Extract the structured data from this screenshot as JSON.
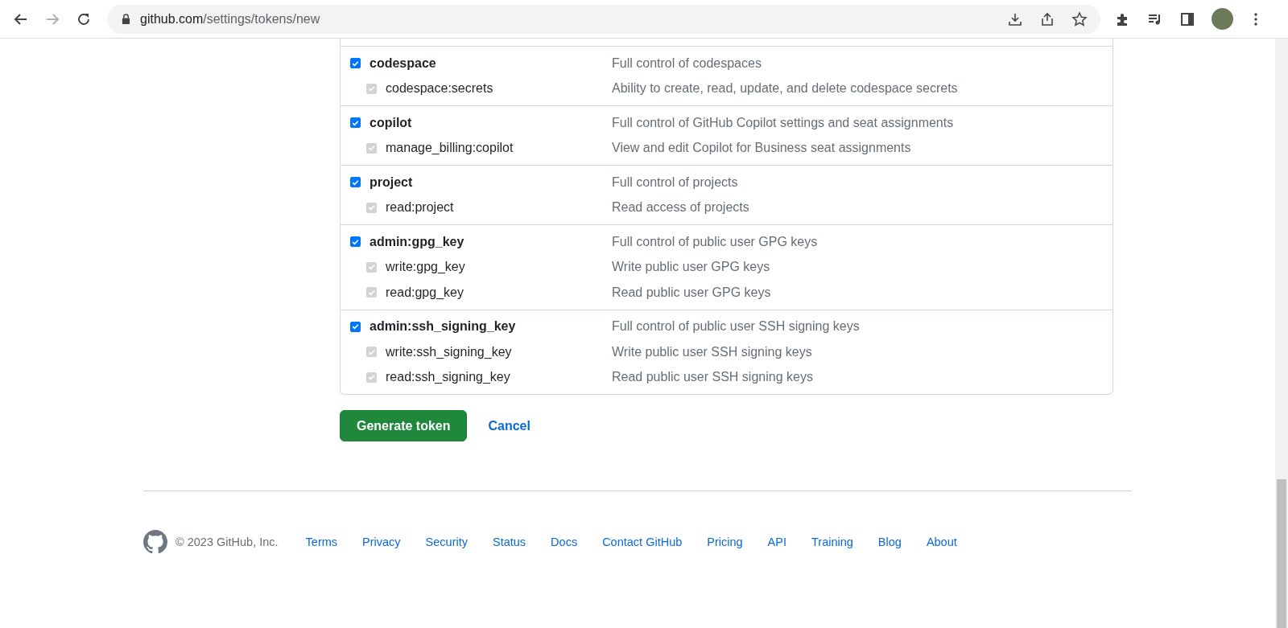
{
  "browser": {
    "url": {
      "host": "github.com",
      "path": "/settings/tokens/new"
    },
    "forward_disabled": true
  },
  "scope_groups": [
    {
      "name": "codespace",
      "description": "Full control of codespaces",
      "checked": true,
      "children": [
        {
          "name": "codespace:secrets",
          "description": "Ability to create, read, update, and delete codespace secrets",
          "checked": true,
          "disabled": true
        }
      ]
    },
    {
      "name": "copilot",
      "description": "Full control of GitHub Copilot settings and seat assignments",
      "checked": true,
      "children": [
        {
          "name": "manage_billing:copilot",
          "description": "View and edit Copilot for Business seat assignments",
          "checked": true,
          "disabled": true
        }
      ]
    },
    {
      "name": "project",
      "description": "Full control of projects",
      "checked": true,
      "children": [
        {
          "name": "read:project",
          "description": "Read access of projects",
          "checked": true,
          "disabled": true
        }
      ]
    },
    {
      "name": "admin:gpg_key",
      "description": "Full control of public user GPG keys",
      "checked": true,
      "children": [
        {
          "name": "write:gpg_key",
          "description": "Write public user GPG keys",
          "checked": true,
          "disabled": true
        },
        {
          "name": "read:gpg_key",
          "description": "Read public user GPG keys",
          "checked": true,
          "disabled": true
        }
      ]
    },
    {
      "name": "admin:ssh_signing_key",
      "description": "Full control of public user SSH signing keys",
      "checked": true,
      "children": [
        {
          "name": "write:ssh_signing_key",
          "description": "Write public user SSH signing keys",
          "checked": true,
          "disabled": true
        },
        {
          "name": "read:ssh_signing_key",
          "description": "Read public user SSH signing keys",
          "checked": true,
          "disabled": true
        }
      ]
    }
  ],
  "actions": {
    "primary": "Generate token",
    "secondary": "Cancel"
  },
  "footer": {
    "copyright": "© 2023 GitHub, Inc.",
    "links": [
      "Terms",
      "Privacy",
      "Security",
      "Status",
      "Docs",
      "Contact GitHub",
      "Pricing",
      "API",
      "Training",
      "Blog",
      "About"
    ]
  }
}
